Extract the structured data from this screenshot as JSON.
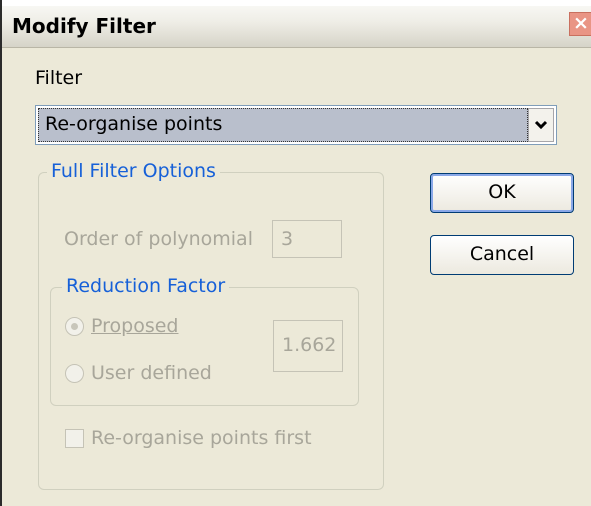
{
  "window": {
    "title": "Modify Filter"
  },
  "filter": {
    "label": "Filter",
    "selected": "Re-organise points"
  },
  "full_filter_options": {
    "legend": "Full Filter Options",
    "order_label": "Order of polynomial",
    "order_value": "3",
    "reduction_factor": {
      "legend": "Reduction Factor",
      "proposed_label": "Proposed",
      "user_defined_label": "User defined",
      "value": "1.662",
      "selected": "Proposed"
    },
    "reorganise_first_label": "Re-organise points first",
    "reorganise_first_checked": false
  },
  "buttons": {
    "ok": "OK",
    "cancel": "Cancel"
  },
  "colors": {
    "dialog_bg": "#ece9d8",
    "group_title": "#1660d8",
    "disabled_text": "#a8a69a",
    "close_button": "#e99585",
    "selection": "#b9bfcc"
  }
}
